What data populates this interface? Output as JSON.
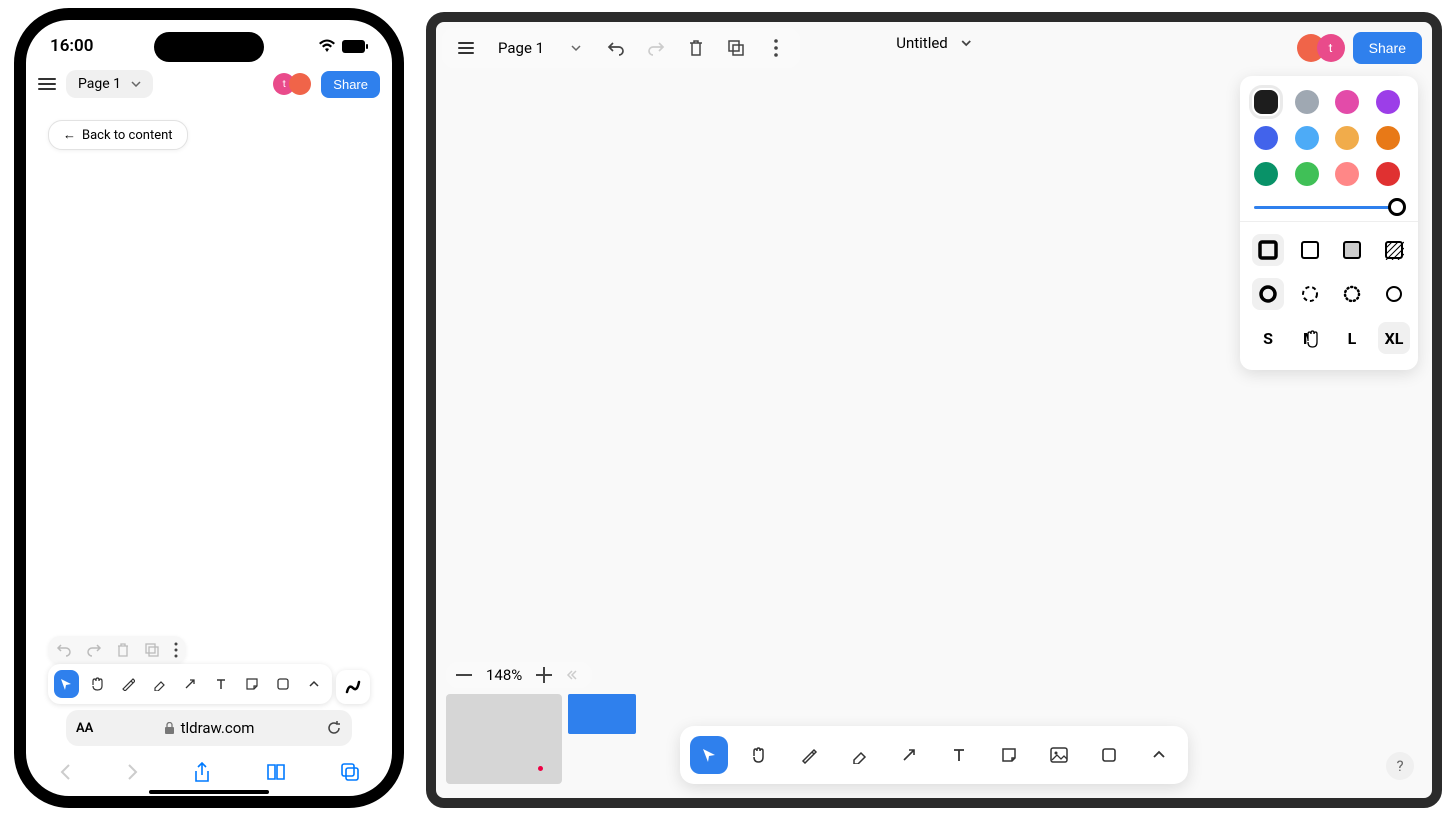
{
  "phone": {
    "time": "16:00",
    "page_label": "Page 1",
    "share_label": "Share",
    "back_label": "Back to content",
    "url": "tldraw.com",
    "aa": "AA",
    "avatars": [
      {
        "letter": "t",
        "color": "#e94b8b"
      },
      {
        "letter": "",
        "color": "#f06449"
      }
    ]
  },
  "desktop": {
    "page_label": "Page 1",
    "title": "Untitled",
    "share_label": "Share",
    "zoom": "148%",
    "help": "?",
    "avatars": [
      {
        "letter": "",
        "color": "#f06449"
      },
      {
        "letter": "t",
        "color": "#e94b8b"
      }
    ]
  },
  "style_panel": {
    "colors": [
      {
        "name": "black",
        "hex": "#1d1d1d",
        "selected": true
      },
      {
        "name": "grey",
        "hex": "#9fa8b2"
      },
      {
        "name": "magenta",
        "hex": "#e34ba9"
      },
      {
        "name": "purple",
        "hex": "#9c3ee8"
      },
      {
        "name": "blue",
        "hex": "#4263eb"
      },
      {
        "name": "light-blue",
        "hex": "#4dabf7"
      },
      {
        "name": "yellow",
        "hex": "#f1ac4b"
      },
      {
        "name": "orange",
        "hex": "#e87917"
      },
      {
        "name": "dark-green",
        "hex": "#099268"
      },
      {
        "name": "green",
        "hex": "#40c057"
      },
      {
        "name": "light-red",
        "hex": "#ff8787"
      },
      {
        "name": "red",
        "hex": "#e03131"
      }
    ],
    "opacity": 100,
    "fills": [
      "none",
      "solid",
      "semi",
      "pattern"
    ],
    "fill_selected": 0,
    "dashes": [
      "draw",
      "dashed",
      "dotted",
      "solid"
    ],
    "dash_selected": 0,
    "sizes": [
      "S",
      "M",
      "L",
      "XL"
    ],
    "size_selected": 3
  },
  "tools": {
    "items": [
      "select",
      "hand",
      "draw",
      "eraser",
      "arrow",
      "text",
      "note",
      "image",
      "shape",
      "more"
    ],
    "active": "select"
  }
}
